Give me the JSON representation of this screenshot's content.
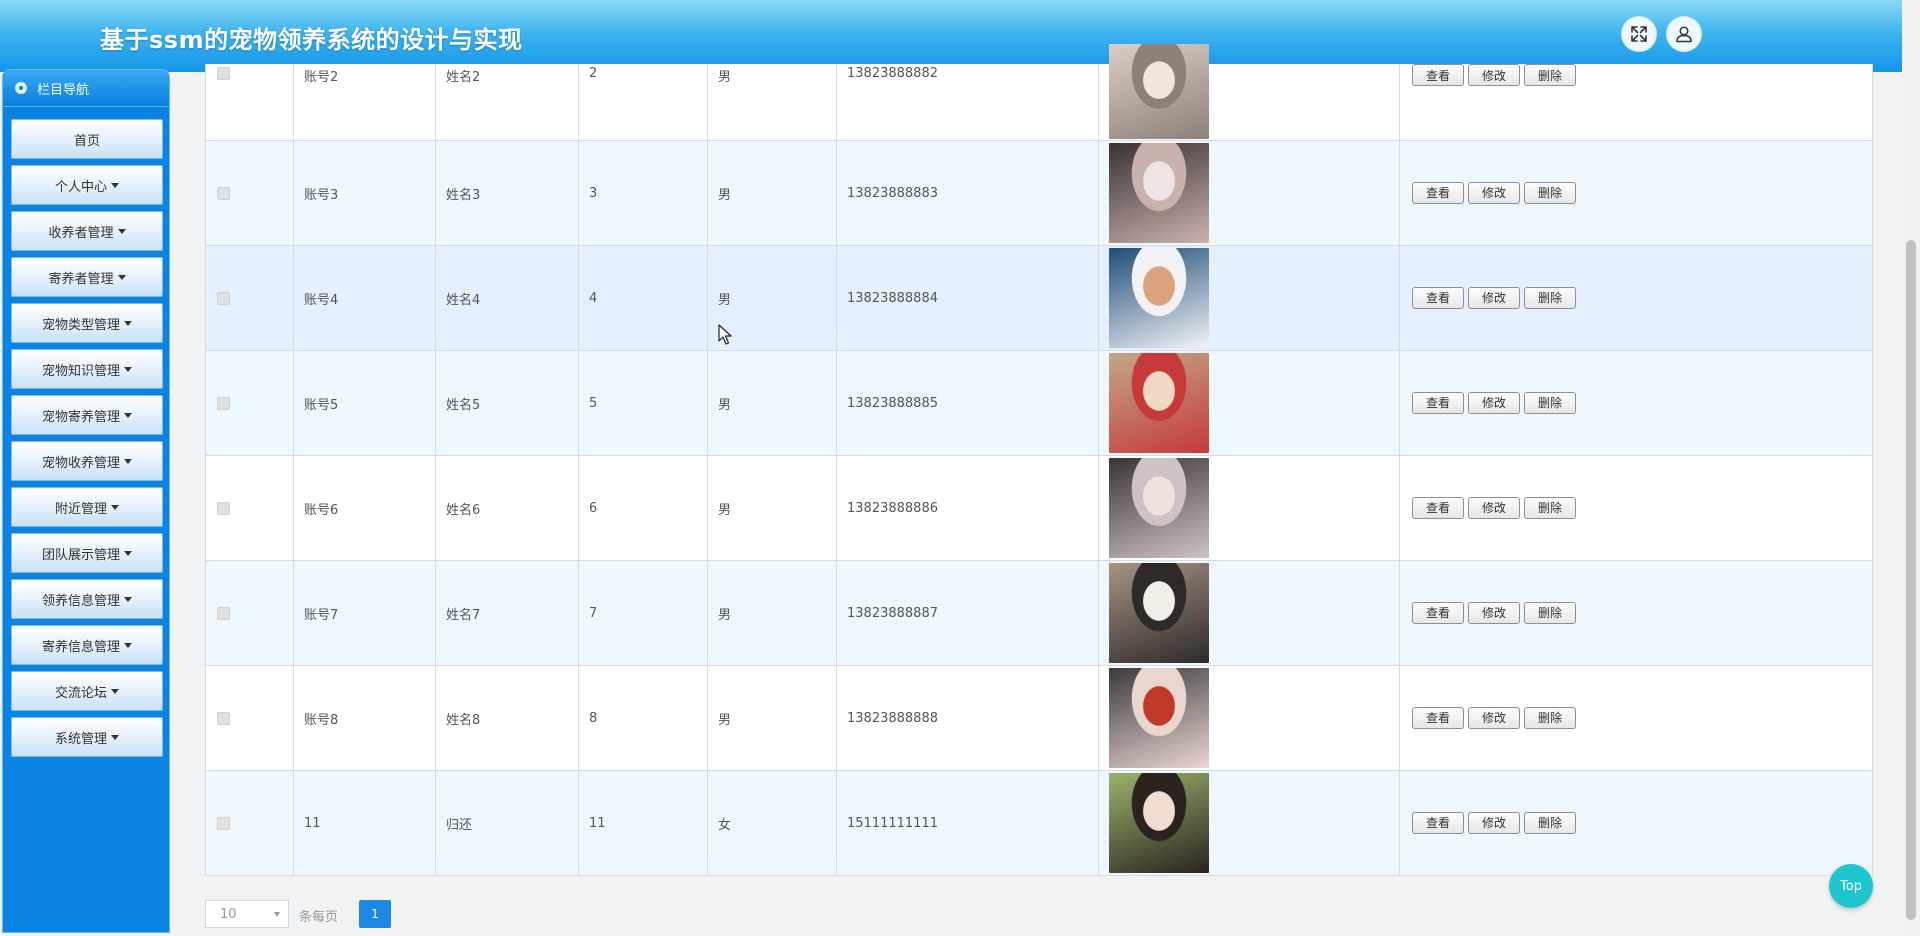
{
  "header": {
    "title": "基于ssm的宠物领养系统的设计与实现"
  },
  "sidebar": {
    "title": "栏目导航",
    "items": [
      {
        "label": "首页",
        "caret": false
      },
      {
        "label": "个人中心",
        "caret": true
      },
      {
        "label": "收养者管理",
        "caret": true
      },
      {
        "label": "寄养者管理",
        "caret": true
      },
      {
        "label": "宠物类型管理",
        "caret": true
      },
      {
        "label": "宠物知识管理",
        "caret": true
      },
      {
        "label": "宠物寄养管理",
        "caret": true
      },
      {
        "label": "宠物收养管理",
        "caret": true
      },
      {
        "label": "附近管理",
        "caret": true
      },
      {
        "label": "团队展示管理",
        "caret": true
      },
      {
        "label": "领养信息管理",
        "caret": true
      },
      {
        "label": "寄养信息管理",
        "caret": true
      },
      {
        "label": "交流论坛",
        "caret": true
      },
      {
        "label": "系统管理",
        "caret": true
      }
    ]
  },
  "table": {
    "action_labels": {
      "view": "查看",
      "edit": "修改",
      "delete": "删除"
    },
    "rows": [
      {
        "account": "账号2",
        "name": "姓名2",
        "age": "2",
        "gender": "男",
        "phone": "13823888882",
        "photo_colors": [
          "#d9cfc6",
          "#8e7f78",
          "#f2e6dc"
        ]
      },
      {
        "account": "账号3",
        "name": "姓名3",
        "age": "3",
        "gender": "男",
        "phone": "13823888883",
        "photo_colors": [
          "#3a3234",
          "#c9b2ad",
          "#efe4e4"
        ]
      },
      {
        "account": "账号4",
        "name": "姓名4",
        "age": "4",
        "gender": "男",
        "phone": "13823888884",
        "photo_colors": [
          "#1f4d78",
          "#f2f2f5",
          "#d9a37c"
        ]
      },
      {
        "account": "账号5",
        "name": "姓名5",
        "age": "5",
        "gender": "男",
        "phone": "13823888885",
        "photo_colors": [
          "#c2a788",
          "#c63a3a",
          "#f0d8c2"
        ]
      },
      {
        "account": "账号6",
        "name": "姓名6",
        "age": "6",
        "gender": "男",
        "phone": "13823888886",
        "photo_colors": [
          "#3a3436",
          "#cfc2c4",
          "#efe2dc"
        ]
      },
      {
        "account": "账号7",
        "name": "姓名7",
        "age": "7",
        "gender": "男",
        "phone": "13823888887",
        "photo_colors": [
          "#a89384",
          "#2e2a2a",
          "#f3ede8"
        ]
      },
      {
        "account": "账号8",
        "name": "姓名8",
        "age": "8",
        "gender": "男",
        "phone": "13823888888",
        "photo_colors": [
          "#3b3a40",
          "#e9d6cf",
          "#c0392b"
        ]
      },
      {
        "account": "11",
        "name": "归还",
        "age": "11",
        "gender": "女",
        "phone": "15111111111",
        "photo_colors": [
          "#9ab36b",
          "#2c2321",
          "#f0dcd0"
        ]
      }
    ]
  },
  "pager": {
    "page_size": "10",
    "per_page_label": "条每页",
    "current_page": "1"
  },
  "top_button": {
    "label": "Top"
  },
  "colors": {
    "accent": "#1e88e5",
    "sidebar": "#0b83e3",
    "row_alt": "#eef6fe"
  }
}
